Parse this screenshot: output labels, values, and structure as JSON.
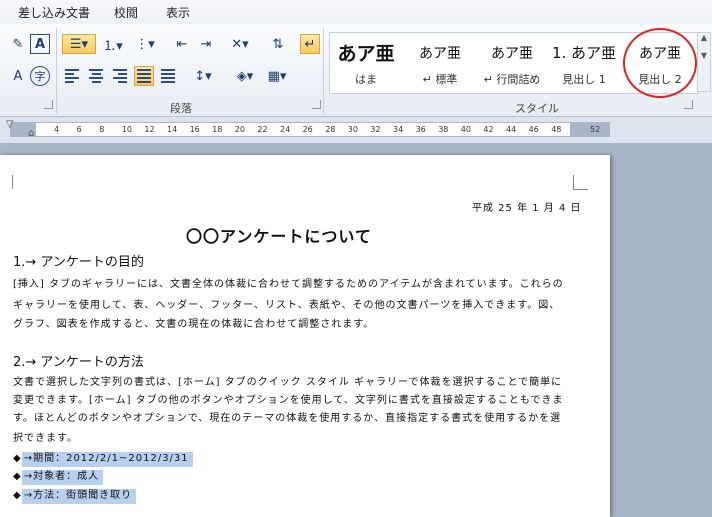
{
  "tabs": [
    "差し込み文書",
    "校閲",
    "表示"
  ],
  "ribbon": {
    "paragraph_group_label": "段落",
    "styles_group_label": "スタイル",
    "styles": [
      {
        "sample": "あア亜",
        "name": "はま"
      },
      {
        "sample": "あア亜",
        "name": "↵ 標準"
      },
      {
        "sample": "あア亜",
        "name": "↵ 行間詰め"
      },
      {
        "sample": "1. あア亜",
        "name": "見出し 1"
      },
      {
        "sample": "あア亜",
        "name": "見出し 2"
      }
    ]
  },
  "ruler": {
    "numbers": [
      "4",
      "6",
      "8",
      "10",
      "12",
      "14",
      "16",
      "18",
      "20",
      "22",
      "24",
      "26",
      "28",
      "30",
      "32",
      "34",
      "36",
      "38",
      "40",
      "42",
      "44",
      "46",
      "48",
      "52"
    ]
  },
  "document": {
    "date": "平成 25 年 1 月 4 日",
    "title": "〇〇アンケートについて",
    "section1_heading": "1.→ アンケートの目的",
    "section1_lines": [
      "[挿入] タブのギャラリーには、文書全体の体裁に合わせて調整するためのアイテムが含まれています。これらの",
      "ギャラリーを使用して、表、ヘッダー、フッター、リスト、表紙や、その他の文書パーツを挿入できます。図、",
      "グラフ、図表を作成すると、文書の現在の体裁に合わせて調整されます。"
    ],
    "section2_heading": "2.→ アンケートの方法",
    "section2_lines": [
      "文書で選択した文字列の書式は、[ホーム] タブのクイック スタイル ギャラリーで体裁を選択することで簡単に",
      "変更できます。[ホーム] タブの他のボタンやオプションを使用して、文字列に書式を直接設定することもできま",
      "す。ほとんどのボタンやオプションで、現在のテーマの体裁を使用するか、直接指定する書式を使用するかを選",
      "択できます。"
    ],
    "bullets": [
      "→期間：2012/2/1~2012/3/31",
      "→対象者：成人",
      "→方法：街頭聞き取り"
    ]
  }
}
